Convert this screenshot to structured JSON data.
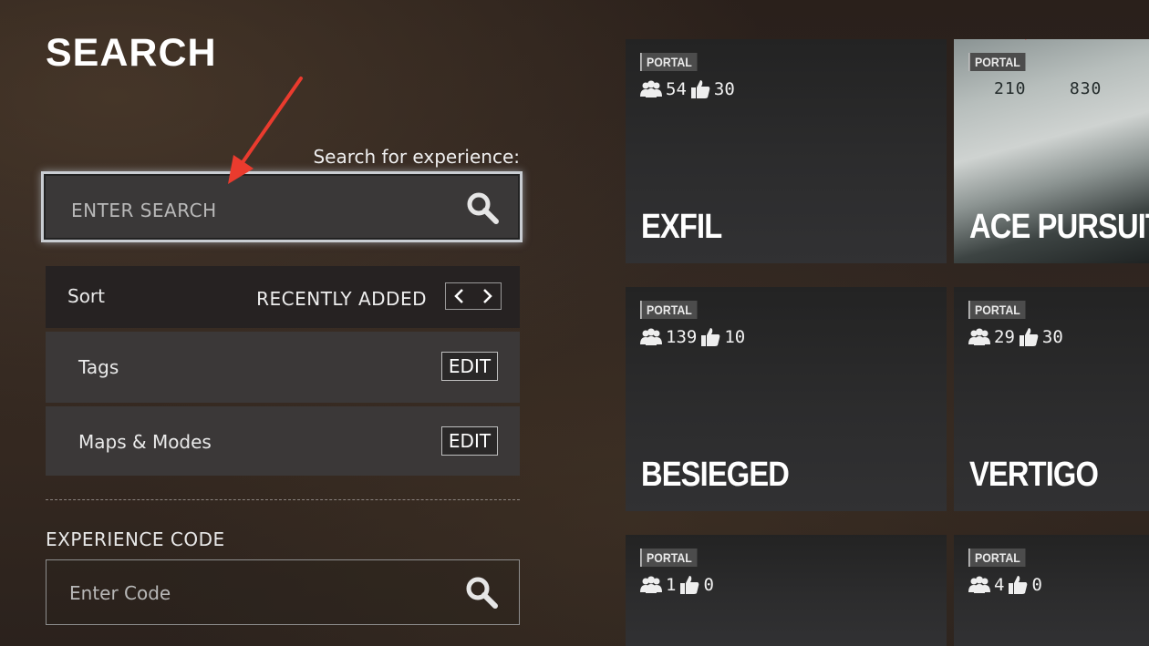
{
  "header": {
    "title": "SEARCH"
  },
  "search": {
    "hint": "Search for experience:",
    "placeholder": "ENTER SEARCH"
  },
  "filters": {
    "sort_label": "Sort",
    "sort_value": "RECENTLY ADDED",
    "tags_label": "Tags",
    "maps_label": "Maps & Modes",
    "edit_label": "EDIT"
  },
  "code": {
    "label": "EXPERIENCE CODE",
    "placeholder": "Enter Code"
  },
  "cards": [
    {
      "badge": "PORTAL",
      "players": "54",
      "likes": "30",
      "title": "EXFIL"
    },
    {
      "badge": "PORTAL",
      "players": "210",
      "likes": "830",
      "title": "ACE PURSUIT"
    },
    {
      "badge": "PORTAL",
      "players": "139",
      "likes": "10",
      "title": "BESIEGED"
    },
    {
      "badge": "PORTAL",
      "players": "29",
      "likes": "30",
      "title": "VERTIGO"
    },
    {
      "badge": "PORTAL",
      "players": "1",
      "likes": "0",
      "title": ""
    },
    {
      "badge": "PORTAL",
      "players": "4",
      "likes": "0",
      "title": ""
    }
  ],
  "icons": {
    "search": "magnifier-icon",
    "players": "players-icon",
    "likes": "thumbs-up-icon",
    "arrow_left": "chevron-left-icon",
    "arrow_right": "chevron-right-icon"
  },
  "colors": {
    "focus_border": "#c9cdd2",
    "panel": "#3b3838",
    "annotation_arrow": "#ea3b2e"
  }
}
